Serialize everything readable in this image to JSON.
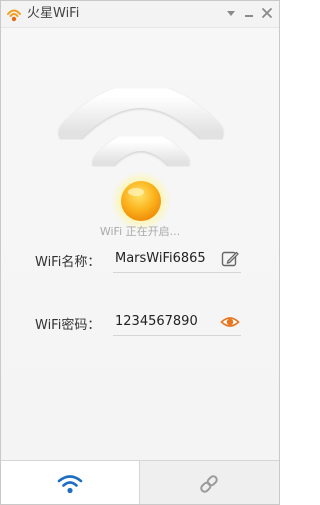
{
  "window": {
    "title": "火星WiFi",
    "logo_icon": "mars-wifi-logo-icon",
    "controls": [
      "dropdown-icon",
      "minimize-icon",
      "close-icon"
    ]
  },
  "hero": {
    "status_text": "WiFi 正在开启..."
  },
  "form": {
    "name_label": "WiFi名称：",
    "name_value": "MarsWiFi6865",
    "name_action_icon": "edit-icon",
    "password_label": "WiFi密码：",
    "password_value": "1234567890",
    "password_action_icon": "eye-icon"
  },
  "tabs": [
    {
      "icon": "wifi-icon",
      "selected": true
    },
    {
      "icon": "link-icon",
      "selected": false
    }
  ],
  "colors": {
    "accent": "#1e6fc4",
    "orb": "#f5a623",
    "eye": "#e8741e"
  }
}
